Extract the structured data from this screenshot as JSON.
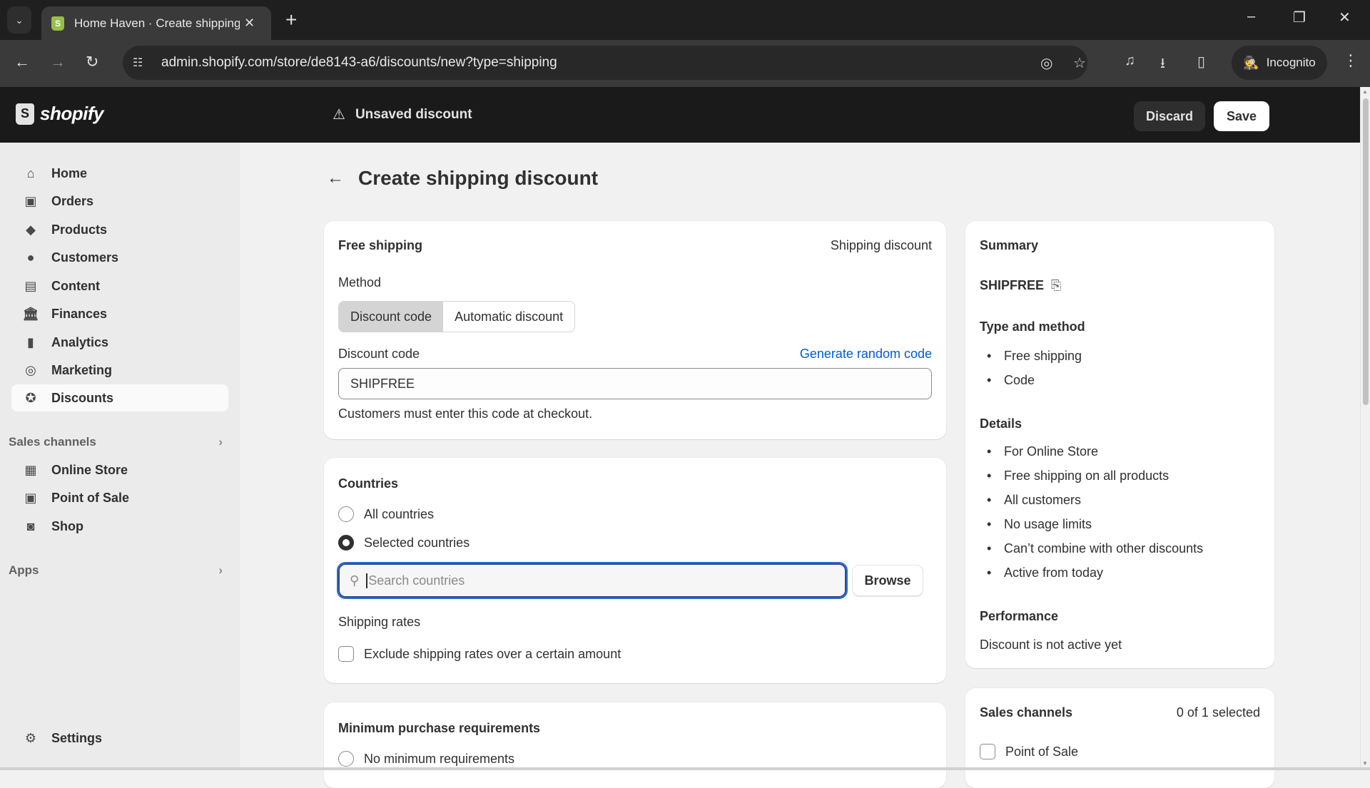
{
  "browser": {
    "tab_title": "Home Haven · Create shipping",
    "url": "admin.shopify.com/store/de8143-a6/discounts/new?type=shipping",
    "incognito_label": "Incognito",
    "icons": {
      "tab_dropdown": "⌄",
      "tab_close": "✕",
      "new_tab": "+",
      "minimize": "–",
      "restore": "❐",
      "close": "✕",
      "back": "←",
      "forward": "→",
      "reload": "↻",
      "site_info": "☷",
      "eye_off": "◎",
      "star": "☆",
      "media": "♫",
      "download": "⭳",
      "side_panel": "▯",
      "incognito": "🕵",
      "menu": "⋮"
    }
  },
  "topbar": {
    "logo_text": "shopify",
    "logo_glyph": "S",
    "status_icon": "⚠",
    "status_text": "Unsaved discount",
    "discard_label": "Discard",
    "save_label": "Save"
  },
  "sidebar": {
    "items": [
      {
        "label": "Home",
        "icon": "⌂"
      },
      {
        "label": "Orders",
        "icon": "▣"
      },
      {
        "label": "Products",
        "icon": "◆"
      },
      {
        "label": "Customers",
        "icon": "●"
      },
      {
        "label": "Content",
        "icon": "▤"
      },
      {
        "label": "Finances",
        "icon": "🏛"
      },
      {
        "label": "Analytics",
        "icon": "▮"
      },
      {
        "label": "Marketing",
        "icon": "◎"
      },
      {
        "label": "Discounts",
        "icon": "✪"
      }
    ],
    "sales_channels_label": "Sales channels",
    "channels": [
      {
        "label": "Online Store",
        "icon": "▦"
      },
      {
        "label": "Point of Sale",
        "icon": "▣"
      },
      {
        "label": "Shop",
        "icon": "◙"
      }
    ],
    "apps_label": "Apps",
    "chevron": "›",
    "settings_label": "Settings",
    "settings_icon": "⚙"
  },
  "page": {
    "back_icon": "←",
    "title": "Create shipping discount"
  },
  "discount_card": {
    "title": "Free shipping",
    "type_label": "Shipping discount",
    "method_label": "Method",
    "method_options": [
      "Discount code",
      "Automatic discount"
    ],
    "method_selected": "Discount code",
    "code_label": "Discount code",
    "generate_link": "Generate random code",
    "code_value": "SHIPFREE",
    "help_text": "Customers must enter this code at checkout."
  },
  "countries_card": {
    "title": "Countries",
    "options": [
      "All countries",
      "Selected countries"
    ],
    "selected": "Selected countries",
    "search_placeholder": "Search countries",
    "search_icon": "⚲",
    "browse_label": "Browse",
    "shipping_rates_title": "Shipping rates",
    "exclude_label": "Exclude shipping rates over a certain amount",
    "exclude_checked": false
  },
  "min_purchase_card": {
    "title": "Minimum purchase requirements",
    "options": [
      "No minimum requirements"
    ]
  },
  "summary": {
    "title": "Summary",
    "code": "SHIPFREE",
    "copy_icon": "⎘",
    "type_method_title": "Type and method",
    "type_method_items": [
      "Free shipping",
      "Code"
    ],
    "details_title": "Details",
    "details_items": [
      "For Online Store",
      "Free shipping on all products",
      "All customers",
      "No usage limits",
      "Can’t combine with other discounts",
      "Active from today"
    ],
    "performance_title": "Performance",
    "performance_text": "Discount is not active yet"
  },
  "sales_channels_card": {
    "title": "Sales channels",
    "count_text": "0 of 1 selected",
    "channels": [
      {
        "label": "Point of Sale",
        "checked": false
      }
    ]
  },
  "colors": {
    "link": "#005bd3",
    "focus_ring": "#2b6fd6",
    "topbar_bg": "#1a1a1a",
    "sidebar_bg": "#ebebeb"
  }
}
